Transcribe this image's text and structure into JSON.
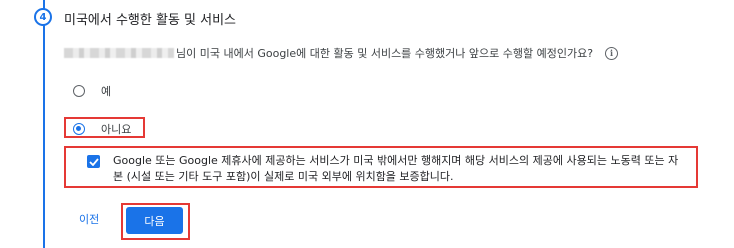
{
  "step": {
    "number": "4",
    "title": "미국에서 수행한 활동 및 서비스"
  },
  "question": {
    "text": "님이 미국 내에서 Google에 대한 활동 및 서비스를 수행했거나 앞으로 수행할 예정인가요?",
    "info_icon": "i"
  },
  "options": [
    {
      "label": "예",
      "selected": false
    },
    {
      "label": "아니요",
      "selected": true
    }
  ],
  "certification": {
    "checked": true,
    "text": "Google 또는 Google 제휴사에 제공하는 서비스가 미국 밖에서만 행해지며 해당 서비스의 제공에 사용되는 노동력 또는 자본 (시설 또는 기타 도구 포함)이 실제로 미국 외부에 위치함을 보증합니다."
  },
  "actions": {
    "prev_label": "이전",
    "next_label": "다음"
  },
  "colors": {
    "accent": "#1a73e8",
    "highlight": "#e53935"
  }
}
